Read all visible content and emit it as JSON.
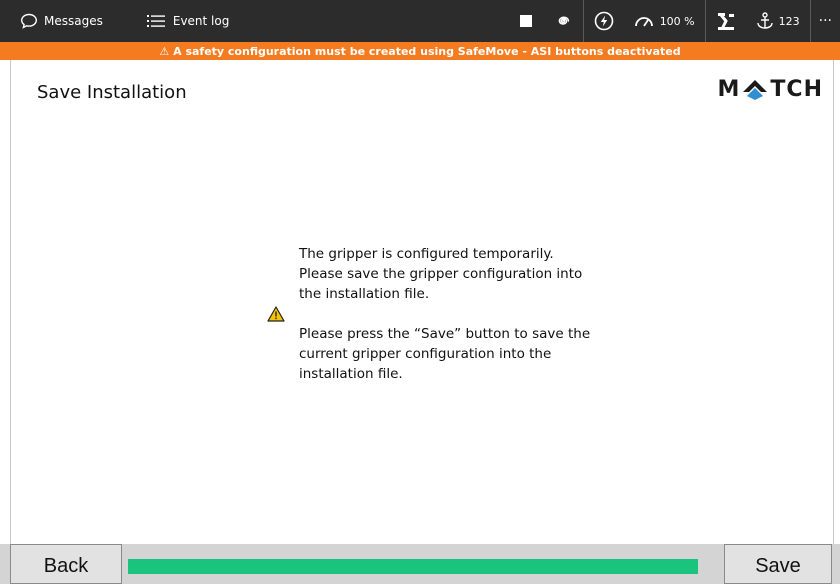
{
  "topbar": {
    "messages_label": "Messages",
    "event_log_label": "Event log",
    "speed_value": "100 %",
    "io_value": "123",
    "more_label": "···"
  },
  "banner": {
    "text": "⚠  A safety configuration must be created using SafeMove - ASI buttons deactivated",
    "color": "#f47b20"
  },
  "page": {
    "title": "Save Installation",
    "logo_left": "M",
    "logo_right": "TCH"
  },
  "message": {
    "paragraph1": "The gripper is configured temporarily. Please save the gripper configuration into the installation file.",
    "paragraph2": "Please press the “Save” button to save the current gripper configuration into the installation file.",
    "icon": "warning-icon"
  },
  "footer": {
    "back_label": "Back",
    "save_label": "Save",
    "progress_fraction": 1.0,
    "progress_color": "#1bc47d"
  }
}
